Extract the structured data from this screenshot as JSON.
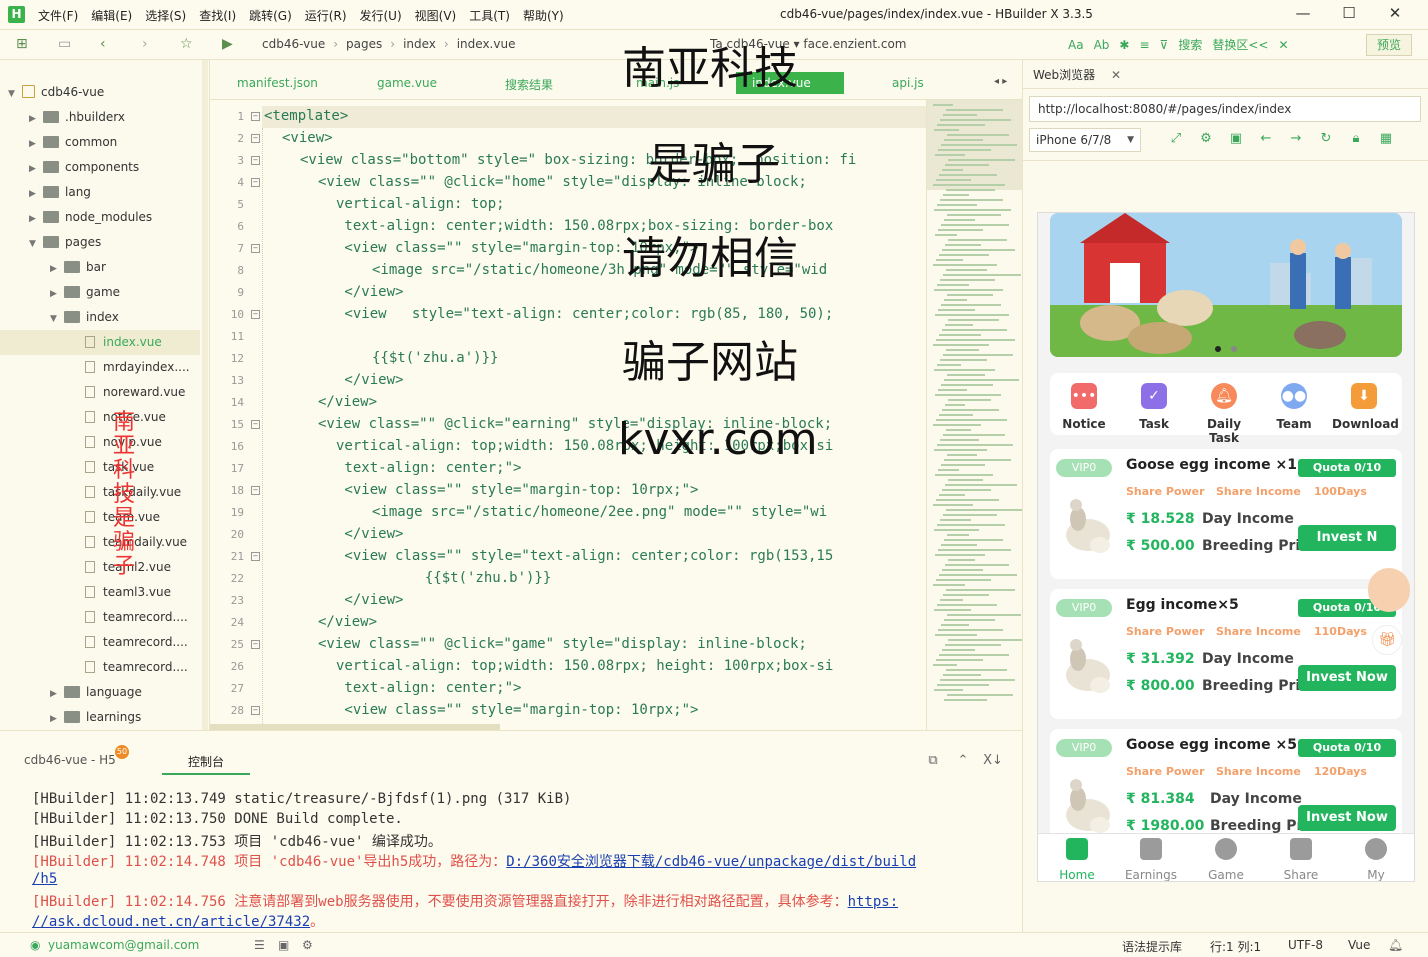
{
  "window": {
    "title": "cdb46-vue/pages/index/index.vue - HBuilder X 3.3.5",
    "app_icon": "H",
    "menus": [
      "文件(F)",
      "编辑(E)",
      "选择(S)",
      "查找(I)",
      "跳转(G)",
      "运行(R)",
      "发行(U)",
      "视图(V)",
      "工具(T)",
      "帮助(Y)"
    ],
    "controls": [
      "minimize-icon",
      "maximize-icon",
      "close-icon"
    ]
  },
  "toolbar": {
    "breadcrumb": [
      "cdb46-vue",
      "pages",
      "index",
      "index.vue"
    ],
    "extra": "Ta cdb46-vue ▾   face.enzient.com",
    "find_labels": [
      "Aa",
      "Ab",
      "搜索",
      "替换区<<"
    ],
    "preview_label": "预览",
    "accent": "#3bb34a"
  },
  "sidebar": {
    "items": [
      {
        "label": "cdb46-vue",
        "level": 0,
        "type": "root",
        "open": true
      },
      {
        "label": ".hbuilderx",
        "level": 1,
        "type": "folder"
      },
      {
        "label": "common",
        "level": 1,
        "type": "folder"
      },
      {
        "label": "components",
        "level": 1,
        "type": "folder"
      },
      {
        "label": "lang",
        "level": 1,
        "type": "folder"
      },
      {
        "label": "node_modules",
        "level": 1,
        "type": "folder"
      },
      {
        "label": "pages",
        "level": 1,
        "type": "folder",
        "open": true
      },
      {
        "label": "bar",
        "level": 2,
        "type": "folder"
      },
      {
        "label": "game",
        "level": 2,
        "type": "folder"
      },
      {
        "label": "index",
        "level": 2,
        "type": "folder",
        "open": true
      },
      {
        "label": "index.vue",
        "level": 3,
        "type": "file",
        "selected": true
      },
      {
        "label": "mrdayindex....",
        "level": 3,
        "type": "file"
      },
      {
        "label": "noreward.vue",
        "level": 3,
        "type": "file"
      },
      {
        "label": "notice.vue",
        "level": 3,
        "type": "file"
      },
      {
        "label": "novip.vue",
        "level": 3,
        "type": "file"
      },
      {
        "label": "task.vue",
        "level": 3,
        "type": "file"
      },
      {
        "label": "taskdaily.vue",
        "level": 3,
        "type": "file"
      },
      {
        "label": "team.vue",
        "level": 3,
        "type": "file"
      },
      {
        "label": "teamdaily.vue",
        "level": 3,
        "type": "file"
      },
      {
        "label": "teaml2.vue",
        "level": 3,
        "type": "file"
      },
      {
        "label": "teaml3.vue",
        "level": 3,
        "type": "file"
      },
      {
        "label": "teamrecord....",
        "level": 3,
        "type": "file"
      },
      {
        "label": "teamrecord....",
        "level": 3,
        "type": "file"
      },
      {
        "label": "teamrecord....",
        "level": 3,
        "type": "file"
      },
      {
        "label": "language",
        "level": 2,
        "type": "folder"
      },
      {
        "label": "learnings",
        "level": 2,
        "type": "folder"
      }
    ]
  },
  "watermarks": {
    "left_vertical": [
      "南",
      "亚",
      "科",
      "技",
      "是",
      "骗",
      "子"
    ],
    "center": [
      "南亚科技",
      "是骗子",
      "请勿相信",
      "骗子网站",
      "kvxr.com"
    ]
  },
  "tabs": [
    "manifest.json",
    "game.vue",
    "搜索结果",
    "main.js",
    "index.vue",
    "api.js"
  ],
  "active_tab": "index.vue",
  "editor": {
    "lines": [
      {
        "n": "1",
        "fold": "⊟",
        "indent": 0,
        "text": "<template>"
      },
      {
        "n": "2",
        "fold": "⊟",
        "indent": 2,
        "text": "<view>"
      },
      {
        "n": "3",
        "fold": "⊟",
        "indent": 4,
        "text": "<view class=\"bottom\" style=\" box-sizing: border-box;  position: fi"
      },
      {
        "n": "4",
        "fold": "⊟",
        "indent": 6,
        "text": "<view class=\"\" @click=\"home\" style=\"display: inline-block;"
      },
      {
        "n": "5",
        "fold": "",
        "indent": 8,
        "text": "vertical-align: top;"
      },
      {
        "n": "6",
        "fold": "",
        "indent": 8,
        "text": " text-align: center;width: 150.08rpx;box-sizing: border-box"
      },
      {
        "n": "7",
        "fold": "⊟",
        "indent": 8,
        "text": " <view class=\"\" style=\"margin-top: 10rpx;\">"
      },
      {
        "n": "8",
        "fold": "",
        "indent": 12,
        "text": "<image src=\"/static/homeone/3h.png\" mode=\"\" style=\"wid"
      },
      {
        "n": "9",
        "fold": "",
        "indent": 8,
        "text": " </view>"
      },
      {
        "n": "10",
        "fold": "⊟",
        "indent": 8,
        "text": " <view   style=\"text-align: center;color: rgb(85, 180, 50);"
      },
      {
        "n": "11",
        "fold": "",
        "indent": 0,
        "text": ""
      },
      {
        "n": "12",
        "fold": "",
        "indent": 12,
        "text": "{{$t('zhu.a')}}"
      },
      {
        "n": "13",
        "fold": "",
        "indent": 8,
        "text": " </view>"
      },
      {
        "n": "14",
        "fold": "",
        "indent": 6,
        "text": "</view>"
      },
      {
        "n": "15",
        "fold": "⊟",
        "indent": 6,
        "text": "<view class=\"\" @click=\"earning\" style=\"display: inline-block;"
      },
      {
        "n": "16",
        "fold": "",
        "indent": 8,
        "text": "vertical-align: top;width: 150.08rpx; height: 100rpx;box-si"
      },
      {
        "n": "17",
        "fold": "",
        "indent": 8,
        "text": " text-align: center;\">"
      },
      {
        "n": "18",
        "fold": "⊟",
        "indent": 8,
        "text": " <view class=\"\" style=\"margin-top: 10rpx;\">"
      },
      {
        "n": "19",
        "fold": "",
        "indent": 12,
        "text": "<image src=\"/static/homeone/2ee.png\" mode=\"\" style=\"wi"
      },
      {
        "n": "20",
        "fold": "",
        "indent": 8,
        "text": " </view>"
      },
      {
        "n": "21",
        "fold": "⊟",
        "indent": 8,
        "text": " <view class=\"\" style=\"text-align: center;color: rgb(153,15"
      },
      {
        "n": "22",
        "fold": "",
        "indent": 16,
        "text": "  {{$t('zhu.b')}}"
      },
      {
        "n": "23",
        "fold": "",
        "indent": 8,
        "text": " </view>"
      },
      {
        "n": "24",
        "fold": "",
        "indent": 6,
        "text": "</view>"
      },
      {
        "n": "25",
        "fold": "⊟",
        "indent": 6,
        "text": "<view class=\"\" @click=\"game\" style=\"display: inline-block;"
      },
      {
        "n": "26",
        "fold": "",
        "indent": 8,
        "text": "vertical-align: top;width: 150.08rpx; height: 100rpx;box-si"
      },
      {
        "n": "27",
        "fold": "",
        "indent": 8,
        "text": " text-align: center;\">"
      },
      {
        "n": "28",
        "fold": "⊟",
        "indent": 8,
        "text": " <view class=\"\" style=\"margin-top: 10rpx;\">"
      }
    ]
  },
  "browser": {
    "tab_label": "Web浏览器",
    "url": "http://localhost:8080/#/pages/index/index",
    "device": "iPhone 6/7/8",
    "icons": [
      "rotate-icon",
      "settings-icon",
      "console-icon",
      "back-icon",
      "forward-icon",
      "refresh-icon",
      "lock-icon",
      "grid-icon"
    ]
  },
  "app": {
    "quick_links": [
      "Notice",
      "Task",
      "Daily Task",
      "Team",
      "Download"
    ],
    "products": [
      {
        "vip": "VIP0",
        "title": "Goose egg income ×1",
        "quota": "Quota 0/10",
        "tags": [
          "Share Power",
          "Share Income",
          "100Days"
        ],
        "daily": "₹ 18.528",
        "price": "₹ 500.00",
        "daily_label": "Day Income",
        "price_label": "Breeding Price",
        "button": "Invest N"
      },
      {
        "vip": "VIP0",
        "title": "Egg income×5",
        "quota": "Quota 0/10",
        "tags": [
          "Share Power",
          "Share Income",
          "110Days"
        ],
        "daily": "₹ 31.392",
        "price": "₹ 800.00",
        "daily_label": "Day Income",
        "price_label": "Breeding Price",
        "button": "Invest Now"
      },
      {
        "vip": "VIP0",
        "title": "Goose egg income ×5",
        "quota": "Quota 0/10",
        "tags": [
          "Share Power",
          "Share Income",
          "120Days"
        ],
        "daily": "₹ 81.384",
        "price": "₹ 1980.00",
        "daily_label": "Day Income",
        "price_label": "Breeding Price",
        "button": "Invest Now"
      }
    ],
    "nav": [
      "Home",
      "Earnings",
      "Game",
      "Share",
      "My"
    ],
    "active_nav": "Home",
    "green": "#23b45e"
  },
  "console": {
    "tab1": "cdb46-vue - H5",
    "badge": "50",
    "tab2": "控制台",
    "lines": [
      {
        "text": "[HBuilder] 11:02:13.749   static/treasure/-Bjfdsf(1).png (317 KiB)",
        "err": false,
        "link": ""
      },
      {
        "text": "[HBuilder] 11:02:13.750  DONE  Build complete.",
        "err": false,
        "link": ""
      },
      {
        "text": "[HBuilder] 11:02:13.753 项目 'cdb46-vue' 编译成功。",
        "err": false,
        "link": ""
      },
      {
        "text": "[HBuilder] 11:02:14.748 项目 'cdb46-vue'导出h5成功，路径为：",
        "err": true,
        "link": "D:/360安全浏览器下载/cdb46-vue/unpackage/dist/build"
      },
      {
        "text": "",
        "err": true,
        "link": "/h5"
      },
      {
        "text": "[HBuilder] 11:02:14.756 注意请部署到web服务器使用，不要使用资源管理器直接打开，除非进行相对路径配置，具体参考：",
        "err": true,
        "link": "https:"
      },
      {
        "text": "",
        "err": true,
        "link": "//ask.dcloud.net.cn/article/37432"
      }
    ],
    "tail": "。"
  },
  "status": {
    "user": "yuamawcom@gmail.com",
    "hint": "语法提示库",
    "pos": "行:1   列:1",
    "encoding": "UTF-8",
    "lang": "Vue"
  }
}
